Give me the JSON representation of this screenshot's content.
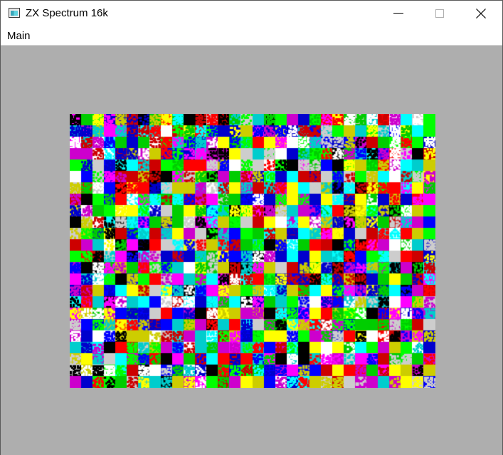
{
  "window": {
    "title": "ZX Spectrum 16k",
    "icon": "app-window-icon"
  },
  "controls": {
    "minimize_icon": "minimize-icon",
    "maximize_icon": "maximize-icon",
    "close_icon": "close-icon"
  },
  "menu": {
    "items": [
      {
        "label": "Main"
      }
    ]
  },
  "display": {
    "description_colors": {
      "border": "#aeaeae",
      "palette": [
        "#000000",
        "#0000cd",
        "#cd0000",
        "#cd00cd",
        "#00cd00",
        "#00cdcd",
        "#cdcd00",
        "#cdcdcd",
        "#0000ff",
        "#ff0000",
        "#ff00ff",
        "#00ff00",
        "#00ffff",
        "#ffff00",
        "#ffffff"
      ]
    }
  }
}
